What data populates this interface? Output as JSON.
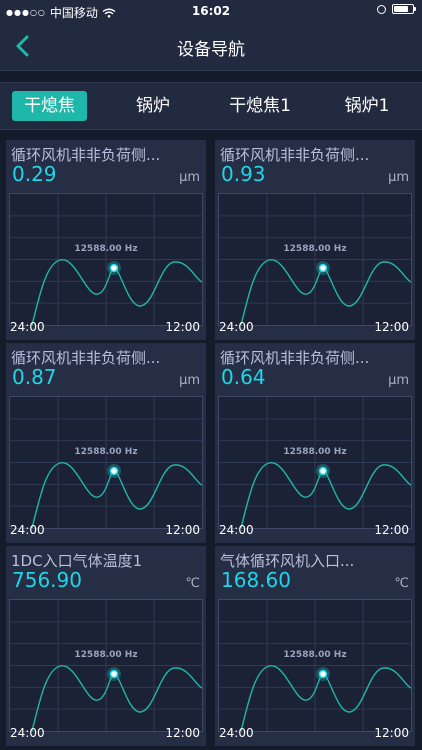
{
  "status_bar": {
    "carrier": "中国移动",
    "time": "16:02",
    "battery_level": 0.75
  },
  "nav": {
    "title": "设备导航",
    "back_icon": "chevron-left-icon"
  },
  "tabs": [
    {
      "label": "干熄焦",
      "active": true
    },
    {
      "label": "锅炉",
      "active": false
    },
    {
      "label": "干熄焦1",
      "active": false
    },
    {
      "label": "锅炉1",
      "active": false
    }
  ],
  "cards": [
    {
      "title": "循环风机非非负荷侧...",
      "value": "0.29",
      "unit": "μm",
      "freq": "12588.00 Hz",
      "x_start": "24:00",
      "x_end": "12:00"
    },
    {
      "title": "循环风机非非负荷侧...",
      "value": "0.93",
      "unit": "μm",
      "freq": "12588.00 Hz",
      "x_start": "24:00",
      "x_end": "12:00"
    },
    {
      "title": "循环风机非非负荷侧...",
      "value": "0.87",
      "unit": "μm",
      "freq": "12588.00 Hz",
      "x_start": "24:00",
      "x_end": "12:00"
    },
    {
      "title": "循环风机非非负荷侧...",
      "value": "0.64",
      "unit": "μm",
      "freq": "12588.00 Hz",
      "x_start": "24:00",
      "x_end": "12:00"
    },
    {
      "title": "1DC入口气体温度1",
      "value": "756.90",
      "unit": "℃",
      "freq": "12588.00 Hz",
      "x_start": "24:00",
      "x_end": "12:00"
    },
    {
      "title": "气体循环风机入口...",
      "value": "168.60",
      "unit": "℃",
      "freq": "12588.00 Hz",
      "x_start": "24:00",
      "x_end": "12:00"
    }
  ],
  "colors": {
    "accent": "#1fb7a9",
    "value": "#1fd6e8",
    "curve": "#1fb7a9",
    "background": "#141b2b",
    "panel": "#262e45"
  }
}
